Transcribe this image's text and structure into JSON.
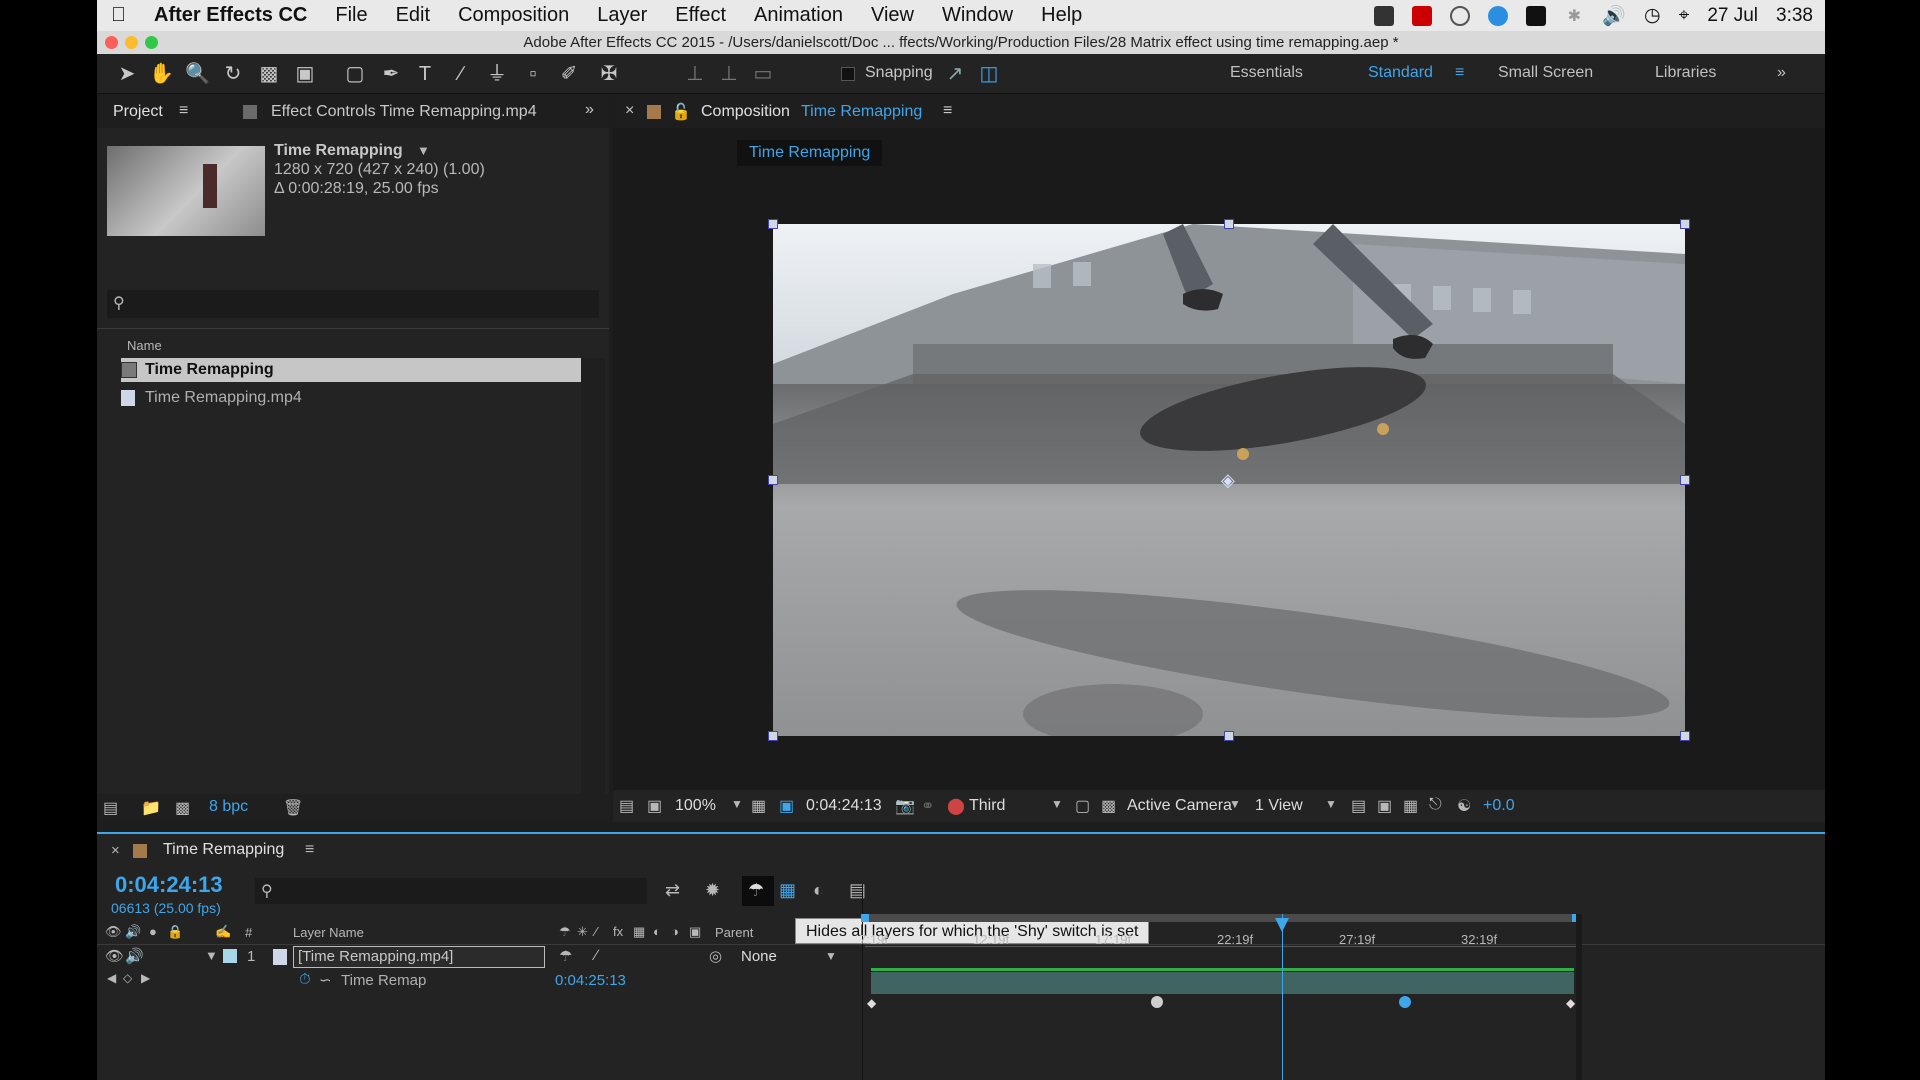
{
  "menubar": {
    "app": "After Effects CC",
    "items": [
      "File",
      "Edit",
      "Composition",
      "Layer",
      "Effect",
      "Animation",
      "View",
      "Window",
      "Help"
    ],
    "date": "27 Jul",
    "time": "3:38"
  },
  "window": {
    "title": "Adobe After Effects CC 2015 - /Users/danielscott/Doc ... ffects/Working/Production Files/28 Matrix effect using time remapping.aep *"
  },
  "toolbar": {
    "snapping": "Snapping",
    "workspaces": [
      "Essentials",
      "Standard",
      "Small Screen",
      "Libraries"
    ],
    "active_workspace": "Standard"
  },
  "project": {
    "tab": "Project",
    "effect_controls_tab": "Effect Controls Time Remapping.mp4",
    "item_name": "Time Remapping",
    "item_dims": "1280 x 720  (427 x 240) (1.00)",
    "item_duration": "Δ 0:00:28:19, 25.00 fps",
    "name_header": "Name",
    "items": [
      "Time Remapping",
      "Time Remapping.mp4"
    ],
    "bpc": "8 bpc"
  },
  "composition": {
    "tab_label": "Composition",
    "tab_name": "Time Remapping",
    "breadcrumb": "Time Remapping",
    "zoom": "100%",
    "timecode": "0:04:24:13",
    "resolution": "Third",
    "camera": "Active Camera",
    "views": "1 View",
    "exposure": "+0.0"
  },
  "timeline": {
    "tab": "Time Remapping",
    "timecode": "0:04:24:13",
    "frames": "06613 (25.00 fps)",
    "ruler_labels": [
      "7:19f",
      "12:19f",
      "17:19f",
      "22:19f",
      "27:19f",
      "32:19f"
    ],
    "tooltip": "Hides all layers for which the 'Shy' switch is set",
    "headers": {
      "layer_name": "Layer Name",
      "hash": "#",
      "parent": "Parent"
    },
    "layer": {
      "index": "1",
      "name": "[Time Remapping.mp4]",
      "parent": "None"
    },
    "property": {
      "name": "Time Remap",
      "value": "0:04:25:13"
    },
    "playhead_fraction": 0.586
  },
  "colors": {
    "accent": "#3ea6ea",
    "bar": "#62b3b0",
    "selection": "#c6c6c6"
  }
}
